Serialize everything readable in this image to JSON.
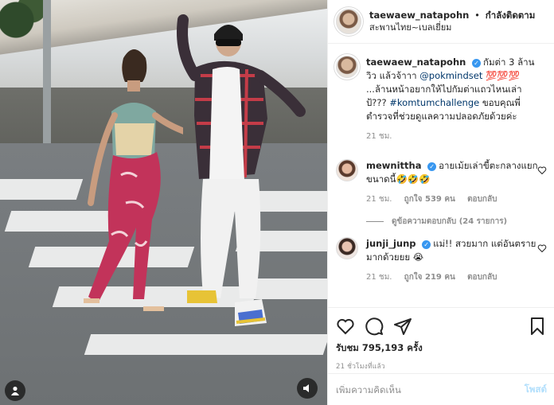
{
  "post": {
    "author": "taewaew_natapohn",
    "separator": "•",
    "follow_label": "กำลังติดตาม",
    "location": "สะพานไทย~เบลเยี่ยม",
    "caption": {
      "username": "taewaew_natapohn",
      "text_1": "กัมต่า 3 ล้านวิว แล้วจ้าาา ",
      "mention": "@pokmindset",
      "text_2": " 💯💯💯 ...ล้านหน้าอยากให้ไปกัมต่าแถวไหนเล่าป้???",
      "hashtag": "#komtumchallenge",
      "text_3": " ขอบคุณพี่ตำรวจที่ช่วยดูแลความปลอดภัยด้วยค่ะ",
      "time": "21 ชม."
    },
    "comments": [
      {
        "username": "mewnittha",
        "text": "อายเม้ยเล่าขี้ตะกลางแยกขนาดนี้🤣🤣🤣",
        "time": "21 ชม.",
        "likes": "ถูกใจ 539 คน",
        "reply": "ตอบกลับ",
        "view_replies": "ดูข้อความตอบกลับ (24 รายการ)"
      },
      {
        "username": "junji_junp",
        "text": "แม่!! สวยมาก แต่อันตรายมากด้วยยย 😭",
        "time": "21 ชม.",
        "likes": "ถูกใจ 219 คน",
        "reply": "ตอบกลับ"
      }
    ],
    "likes_count": "รับชม 795,193 ครั้ง",
    "posted_ago": "21 ชั่วโมงที่แล้ว",
    "add_comment_placeholder": "เพิ่มความคิดเห็น",
    "post_button": "โพสต์"
  },
  "icons": {
    "heart": "heart-icon",
    "comment": "comment-icon",
    "share": "share-icon",
    "save": "bookmark-icon",
    "user": "user-icon",
    "sound": "speaker-icon"
  },
  "colors": {
    "verified": "#3897f0",
    "link": "#00376b",
    "post_disabled": "#b2dffc"
  }
}
